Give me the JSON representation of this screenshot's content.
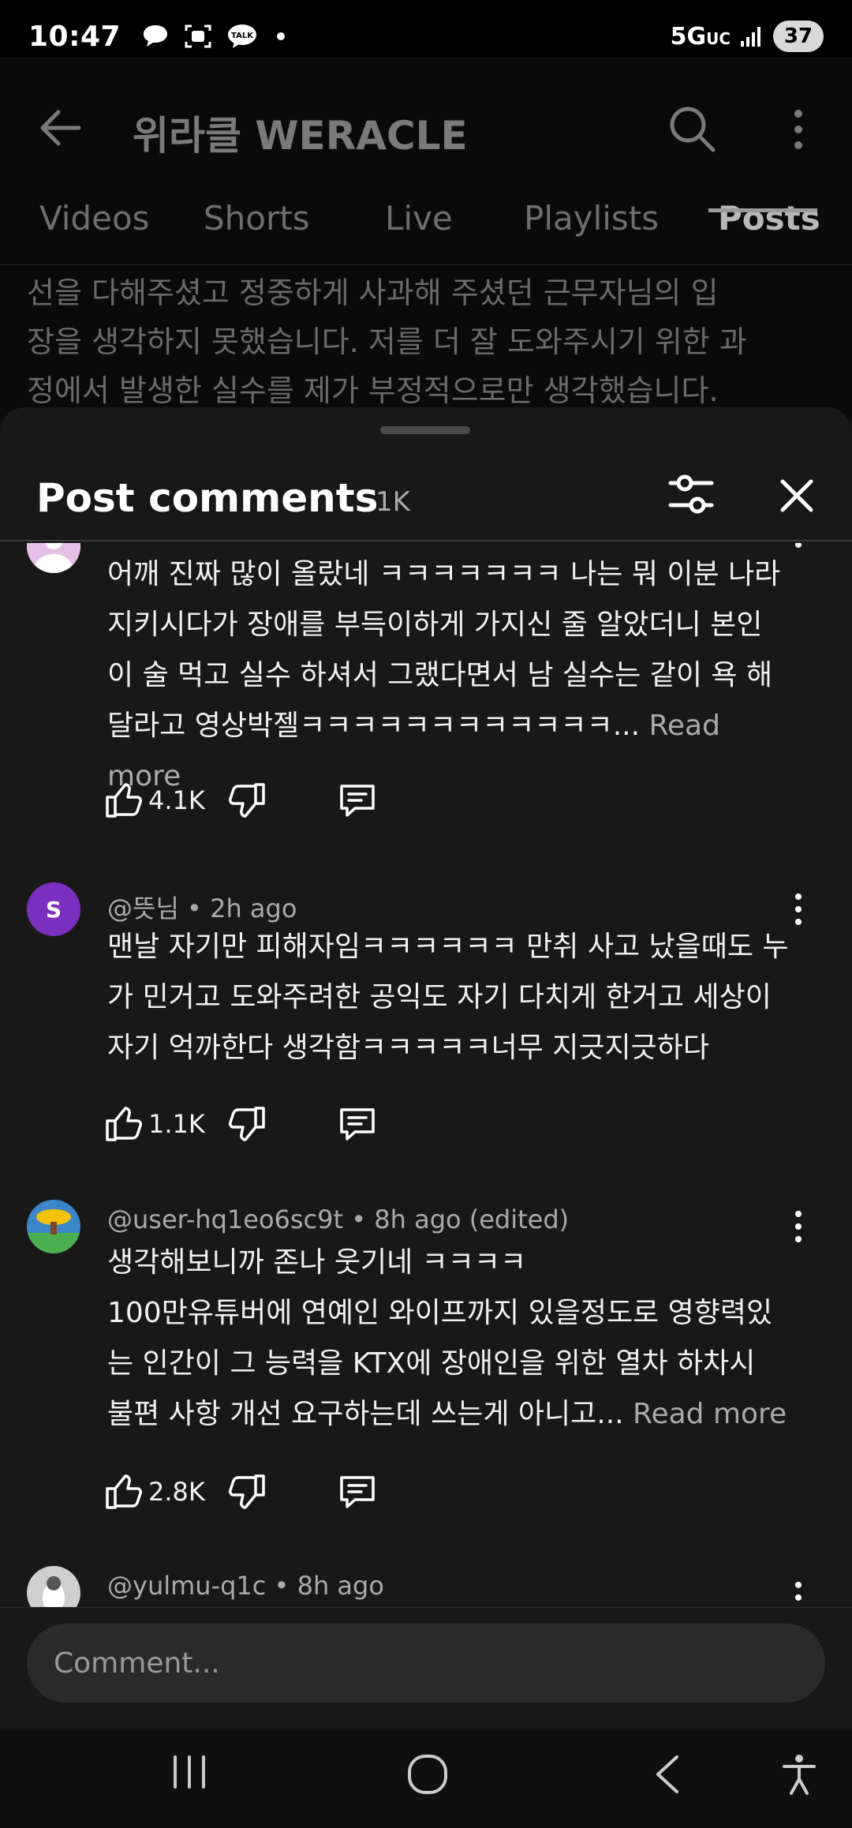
{
  "status_bar": {
    "time": "10:47",
    "network": "5G",
    "network_sub": "UC",
    "battery": "37",
    "notification_icons": [
      "chat-bubble-icon",
      "screenshot-icon",
      "kakaotalk-icon"
    ],
    "talk_label": "TALK"
  },
  "app_bar": {
    "channel_title": "위라클 WERACLE"
  },
  "tabs": [
    {
      "label": "Videos",
      "active": false
    },
    {
      "label": "Shorts",
      "active": false
    },
    {
      "label": "Live",
      "active": false
    },
    {
      "label": "Playlists",
      "active": false
    },
    {
      "label": "Posts",
      "active": true
    }
  ],
  "post_text": {
    "line1": "선을 다해주셨고 정중하게 사과해 주셨던 근무자님의 입",
    "line2": "장을 생각하지 못했습니다. 저를 더 잘 도와주시기 위한 과",
    "line3": "정에서 발생한 실수를 제가 부정적으로만 생각했습니다."
  },
  "sheet": {
    "title": "Post comments",
    "count": "1K"
  },
  "comments": [
    {
      "author_meta": "",
      "lines": [
        "어깨 진짜 많이 올랐네 ㅋㅋㅋㅋㅋㅋㅋ 나는 뭐 이분 나라",
        "지키시다가 장애를 부득이하게 가지신 줄 알았더니 본인",
        "이 술 먹고 실수 하셔서 그랬다면서 남 실수는 같이 욕 해",
        "달라고 영상박젤ㅋㅋㅋㅋㅋㅋㅋㅋㅋㅋㅋㅋ..."
      ],
      "read_more": "Read more",
      "likes": "4.1K",
      "avatar_color": "#e6bfe6"
    },
    {
      "author_meta": "@뜻님 • 2h ago",
      "lines": [
        "맨날 자기만 피해자임ㅋㅋㅋㅋㅋㅋ 만취 사고 났을때도 누",
        "가 민거고 도와주려한 공익도 자기 다치게 한거고 세상이",
        "자기 억까한다 생각함ㅋㅋㅋㅋㅋ너무 지긋지긋하다"
      ],
      "read_more": "",
      "likes": "1.1K",
      "avatar_letter": "S",
      "avatar_color": "#7b2fbf"
    },
    {
      "author_meta": "@user-hq1eo6sc9t • 8h ago (edited)",
      "lines": [
        "생각해보니까 존나 웃기네 ㅋㅋㅋㅋ",
        "100만유튜버에 연예인 와이프까지 있을정도로 영향력있",
        "는 인간이 그 능력을 KTX에 장애인을 위한 열차 하차시",
        "불편 사항 개선 요구하는데 쓰는게 아니고..."
      ],
      "read_more": "Read more",
      "likes": "2.8K",
      "avatar_color": "#3a86c8"
    },
    {
      "author_meta": "@yulmu-q1c • 8h ago",
      "lines": [],
      "read_more": "",
      "likes": "",
      "avatar_color": "#cfcfcf"
    }
  ],
  "comment_input": {
    "placeholder": "Comment..."
  }
}
